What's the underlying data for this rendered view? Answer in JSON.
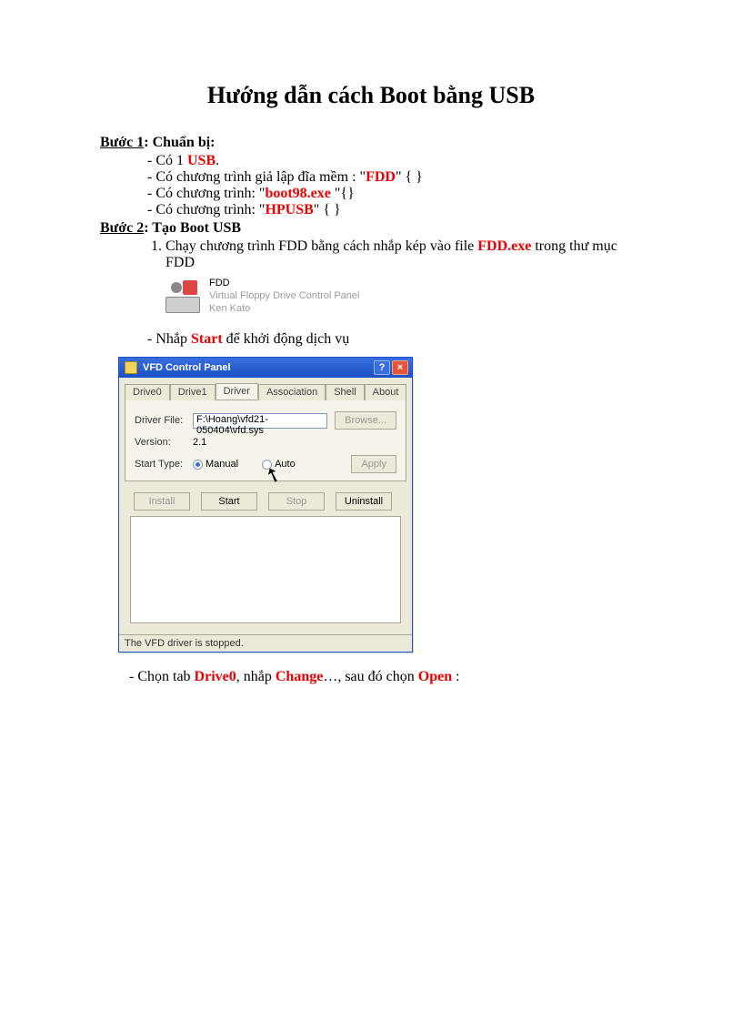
{
  "title": "Hướng dẫn cách Boot bằng USB",
  "step1": {
    "heading_u": "Bước 1",
    "heading_rest": ": Chuẩn bị:",
    "items": {
      "i1_pre": "Có 1 ",
      "i1_red": "USB",
      "i1_post": ".",
      "i2_pre": "Có chương trình giả lập đĩa mềm : \"",
      "i2_red": "FDD",
      "i2_post": "\" { }",
      "i3_pre": "Có chương trình: \"",
      "i3_red": "boot98.exe",
      "i3_mid": " \"{}",
      "i4_pre": "Có chương trình: \"",
      "i4_red": "HPUSB",
      "i4_post": "\" { }"
    }
  },
  "step2": {
    "heading_u": "Bước 2",
    "heading_rest": ": Tạo Boot USB",
    "ol1_pre": "Chạy chương trình FDD bằng cách nhắp kép vào file ",
    "ol1_red": "FDD.exe",
    "ol1_post": " trong thư mục FDD",
    "file": {
      "name": "FDD",
      "desc1": "Virtual Floppy Drive Control Panel",
      "desc2": "Ken Kato"
    },
    "bullet_start_pre": "Nhắp ",
    "bullet_start_red": "Start",
    "bullet_start_post": " để khởi động dịch vụ"
  },
  "vfd": {
    "title": "VFD Control Panel",
    "tabs": {
      "t0": "Drive0",
      "t1": "Drive1",
      "t2": "Driver",
      "t3": "Association",
      "t4": "Shell",
      "t5": "About"
    },
    "labels": {
      "driver_file": "Driver File:",
      "version": "Version:",
      "version_val": "2.1",
      "start_type": "Start Type:",
      "manual": "Manual",
      "auto": "Auto"
    },
    "driver_path": "F:\\Hoang\\vfd21-050404\\vfd.sys",
    "buttons": {
      "browse": "Browse...",
      "apply": "Apply",
      "install": "Install",
      "start": "Start",
      "stop": "Stop",
      "uninstall": "Uninstall"
    },
    "status": "The VFD driver is stopped."
  },
  "tail": {
    "pre": "Chọn tab ",
    "red1": "Drive0",
    "mid1": ", nhắp ",
    "red2": "Change",
    "mid2": "…, sau đó chọn ",
    "red3": "Open",
    "end": " :"
  }
}
